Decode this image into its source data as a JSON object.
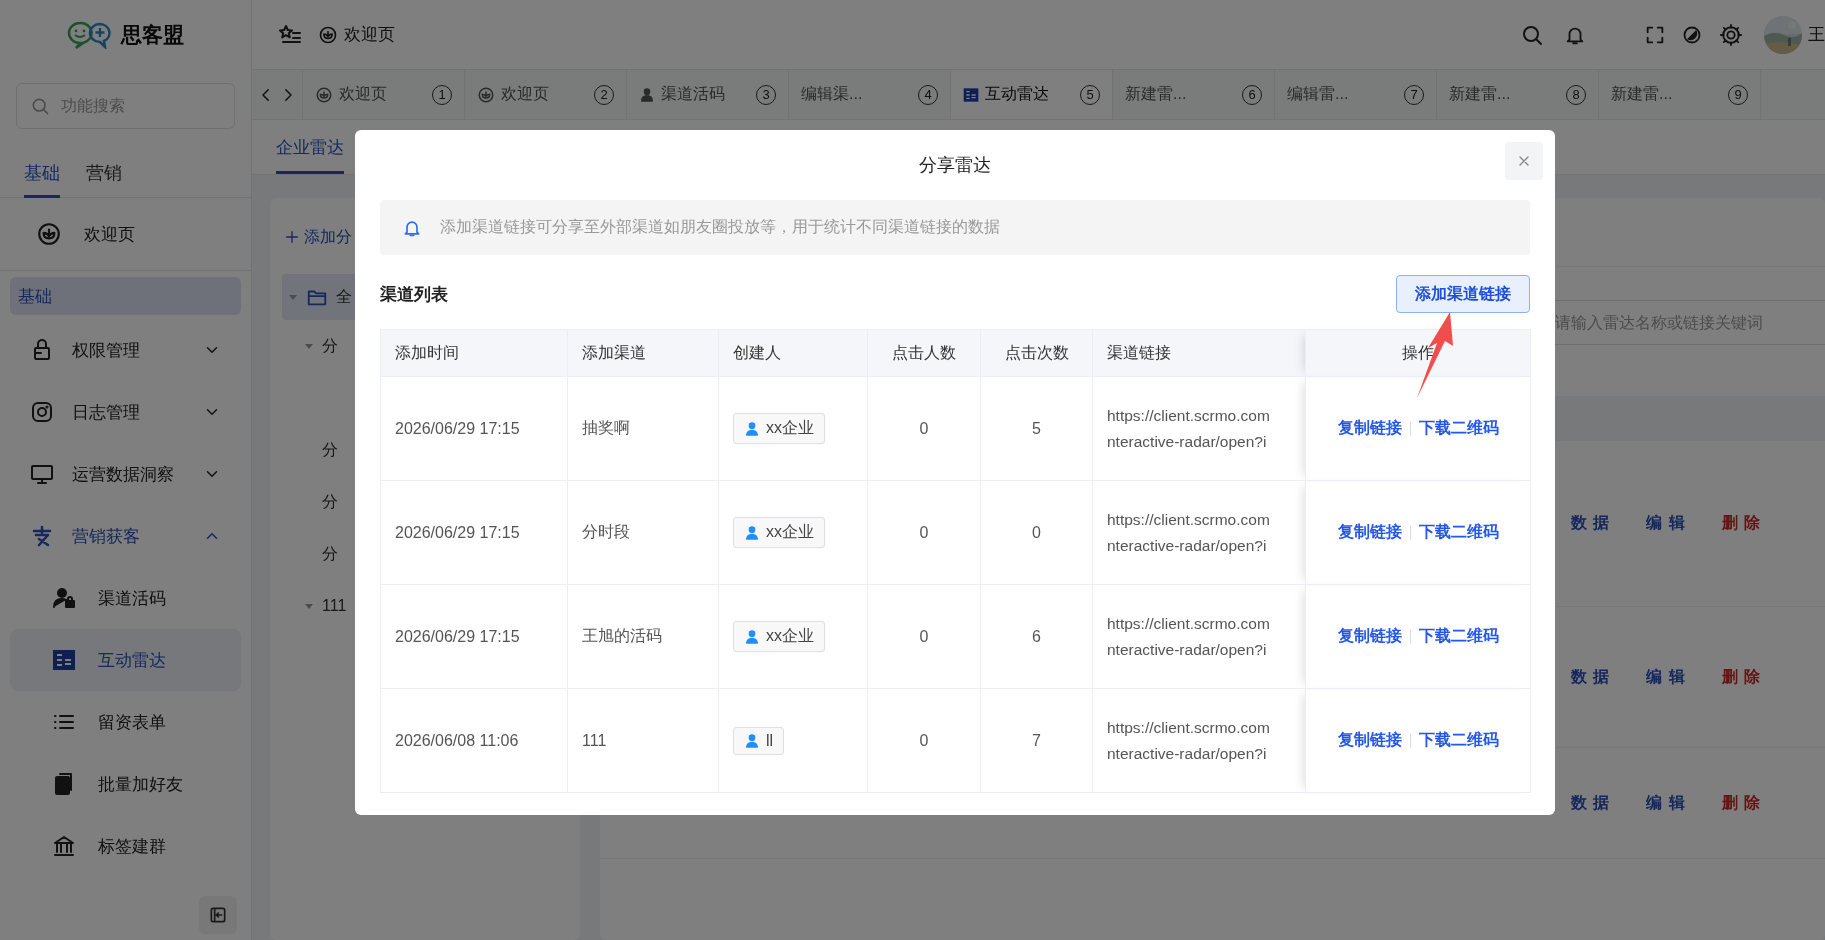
{
  "sidebar": {
    "logo_text": "思客盟",
    "search": {
      "placeholder": "功能搜索"
    },
    "tabs": [
      {
        "label": "基础",
        "selected": true
      },
      {
        "label": "营销",
        "selected": false
      }
    ],
    "home_item": {
      "label": "欢迎页"
    },
    "group_label": "基础",
    "menu": [
      {
        "label": "权限管理",
        "expanded": false
      },
      {
        "label": "日志管理",
        "expanded": false
      },
      {
        "label": "运营数据洞察",
        "expanded": false
      },
      {
        "label": "营销获客",
        "expanded": true,
        "children": [
          {
            "label": "渠道活码",
            "selected": false
          },
          {
            "label": "互动雷达",
            "selected": true
          },
          {
            "label": "留资表单",
            "selected": false
          },
          {
            "label": "批量加好友",
            "selected": false
          },
          {
            "label": "标签建群",
            "selected": false
          }
        ]
      }
    ]
  },
  "header": {
    "breadcrumb": "欢迎页",
    "user_name": "王"
  },
  "tabs": [
    {
      "label": "欢迎页",
      "number": "1",
      "selected": false
    },
    {
      "label": "欢迎页",
      "number": "2",
      "selected": false
    },
    {
      "label": "渠道活码",
      "number": "3",
      "selected": false
    },
    {
      "label": "编辑渠...",
      "number": "4",
      "selected": false
    },
    {
      "label": "互动雷达",
      "number": "5",
      "selected": true
    },
    {
      "label": "新建雷...",
      "number": "6",
      "selected": false
    },
    {
      "label": "编辑雷...",
      "number": "7",
      "selected": false
    },
    {
      "label": "新建雷...",
      "number": "8",
      "selected": false
    },
    {
      "label": "新建雷...",
      "number": "9",
      "selected": false
    }
  ],
  "page_tabs": [
    {
      "label": "企业雷达",
      "selected": true
    }
  ],
  "tree": {
    "add_label": "添加分",
    "root": {
      "label": "全",
      "expanded": true,
      "selected": true
    },
    "nodes": [
      {
        "label": "分",
        "expanded": true
      },
      {
        "label": "分"
      },
      {
        "label": "分"
      },
      {
        "label": "分"
      },
      {
        "label": "111",
        "expanded": true
      }
    ]
  },
  "radar_list": {
    "search_placeholder": "请输入雷达名称或链接关键词",
    "rows": [
      {
        "actions": [
          {
            "label": "数 据",
            "kind": "normal"
          },
          {
            "label": "编 辑",
            "kind": "normal"
          },
          {
            "label": "删 除",
            "kind": "danger"
          }
        ]
      },
      {
        "actions": [
          {
            "label": "数 据",
            "kind": "normal"
          },
          {
            "label": "编 辑",
            "kind": "normal"
          },
          {
            "label": "删 除",
            "kind": "danger"
          }
        ]
      },
      {
        "actions": [
          {
            "label": "数 据",
            "kind": "normal"
          },
          {
            "label": "编 辑",
            "kind": "normal"
          },
          {
            "label": "删 除",
            "kind": "danger"
          }
        ]
      }
    ]
  },
  "modal": {
    "title": "分享雷达",
    "notice": "添加渠道链接可分享至外部渠道如朋友圈投放等，用于统计不同渠道链接的数据",
    "section_title": "渠道列表",
    "add_button": "添加渠道链接",
    "columns": [
      "添加时间",
      "添加渠道",
      "创建人",
      "点击人数",
      "点击次数",
      "渠道链接",
      "操作"
    ],
    "rows": [
      {
        "time": "2026/06/29 17:15",
        "channel": "抽奖啊",
        "creator": "xx企业",
        "visitors": "0",
        "clicks": "5",
        "link_lines": [
          "https://client.scrmo.com",
          "nteractive-radar/open?i"
        ],
        "actions": [
          "复制链接",
          "下载二维码"
        ]
      },
      {
        "time": "2026/06/29 17:15",
        "channel": "分时段",
        "creator": "xx企业",
        "visitors": "0",
        "clicks": "0",
        "link_lines": [
          "https://client.scrmo.com",
          "nteractive-radar/open?i"
        ],
        "actions": [
          "复制链接",
          "下载二维码"
        ]
      },
      {
        "time": "2026/06/29 17:15",
        "channel": "王旭的活码",
        "creator": "xx企业",
        "visitors": "0",
        "clicks": "6",
        "link_lines": [
          "https://client.scrmo.com",
          "nteractive-radar/open?i"
        ],
        "actions": [
          "复制链接",
          "下载二维码"
        ]
      },
      {
        "time": "2026/06/08 11:06",
        "channel": "111",
        "creator": "ll",
        "visitors": "0",
        "clicks": "7",
        "link_lines": [
          "https://client.scrmo.com",
          "nteractive-radar/open?i"
        ],
        "actions": [
          "复制链接",
          "下载二维码"
        ]
      }
    ]
  }
}
